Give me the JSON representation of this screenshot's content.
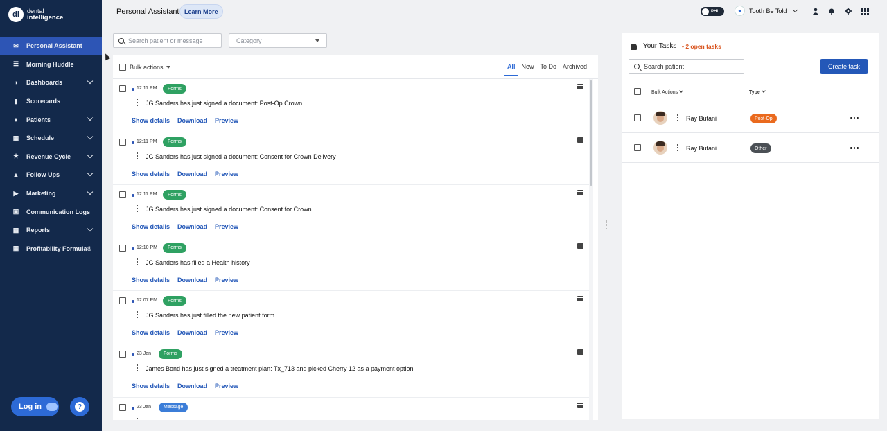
{
  "brand": {
    "logo_mark": "di",
    "line1": "dental",
    "line2": "intelligence"
  },
  "sidebar": {
    "items": [
      {
        "label": "Personal Assistant",
        "icon": "envelope-icon",
        "active": true,
        "expandable": false
      },
      {
        "label": "Morning Huddle",
        "icon": "list-icon",
        "active": false,
        "expandable": false
      },
      {
        "label": "Dashboards",
        "icon": "gauge-icon",
        "active": false,
        "expandable": true
      },
      {
        "label": "Scorecards",
        "icon": "bar-chart-icon",
        "active": false,
        "expandable": false
      },
      {
        "label": "Patients",
        "icon": "users-icon",
        "active": false,
        "expandable": true
      },
      {
        "label": "Schedule",
        "icon": "calendar-icon",
        "active": false,
        "expandable": true
      },
      {
        "label": "Revenue Cycle",
        "icon": "dollar-icon",
        "active": false,
        "expandable": true
      },
      {
        "label": "Follow Ups",
        "icon": "bell-icon",
        "active": false,
        "expandable": true
      },
      {
        "label": "Marketing",
        "icon": "megaphone-icon",
        "active": false,
        "expandable": true
      },
      {
        "label": "Communication Logs",
        "icon": "message-icon",
        "active": false,
        "expandable": false
      },
      {
        "label": "Reports",
        "icon": "report-icon",
        "active": false,
        "expandable": true
      },
      {
        "label": "Profitability Formula®",
        "icon": "grid-icon",
        "active": false,
        "expandable": false
      }
    ],
    "login_label": "Log in",
    "help_label": "?"
  },
  "header": {
    "title": "Personal Assistant",
    "learn_more": "Learn More",
    "phi_label": "PHI",
    "practice_name": "Tooth Be Told"
  },
  "filters": {
    "search_placeholder": "Search patient or message",
    "category_placeholder": "Category"
  },
  "messages_panel": {
    "bulk_actions": "Bulk actions",
    "tabs": [
      {
        "label": "All",
        "active": true
      },
      {
        "label": "New",
        "active": false
      },
      {
        "label": "To Do",
        "active": false
      },
      {
        "label": "Archived",
        "active": false
      }
    ],
    "action_labels": {
      "details": "Show details",
      "download": "Download",
      "preview": "Preview"
    },
    "messages": [
      {
        "time": "12:11 PM",
        "tag": "Forms",
        "tag_type": "forms",
        "text": "JG Sanders has just signed a document: Post-Op Crown"
      },
      {
        "time": "12:11 PM",
        "tag": "Forms",
        "tag_type": "forms",
        "text": "JG Sanders has just signed a document: Consent for Crown Delivery"
      },
      {
        "time": "12:11 PM",
        "tag": "Forms",
        "tag_type": "forms",
        "text": "JG Sanders has just signed a document: Consent for Crown"
      },
      {
        "time": "12:10 PM",
        "tag": "Forms",
        "tag_type": "forms",
        "text": "JG Sanders has filled a Health history"
      },
      {
        "time": "12:07 PM",
        "tag": "Forms",
        "tag_type": "forms",
        "text": "JG Sanders has just filled the new patient form"
      },
      {
        "time": "23 Jan",
        "tag": "Forms",
        "tag_type": "forms",
        "text": "James Bond has just signed a treatment plan: Tx_713 and picked Cherry 12 as a payment option"
      },
      {
        "time": "23 Jan",
        "tag": "Message",
        "tag_type": "message",
        "text": ""
      }
    ]
  },
  "tasks_panel": {
    "title": "Your Tasks",
    "open_count": "2 open tasks",
    "search_placeholder": "Search patient",
    "create_label": "Create task",
    "col_bulk": "Bulk Actions",
    "col_type": "Type",
    "tasks": [
      {
        "name": "Ray Butani",
        "type": "Post-Op",
        "type_class": "postop"
      },
      {
        "name": "Ray Butani",
        "type": "Other",
        "type_class": "other"
      }
    ]
  },
  "colors": {
    "sidebar_bg": "#13294b",
    "active_nav": "#2d55b5",
    "link_blue": "#2458b8",
    "forms_tag": "#2fa162",
    "message_tag": "#3b7dd8",
    "open_tasks_orange": "#d9541e",
    "postop_tag": "#ea6a1e"
  }
}
